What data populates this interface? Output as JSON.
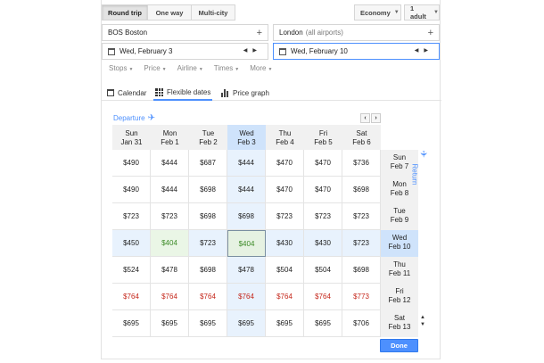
{
  "trip_types": [
    {
      "label": "Round trip",
      "active": true
    },
    {
      "label": "One way",
      "active": false
    },
    {
      "label": "Multi-city",
      "active": false
    }
  ],
  "cabin": {
    "label": "Economy"
  },
  "passengers": {
    "label": "1 adult"
  },
  "origin": {
    "code": "BOS",
    "city": "Boston"
  },
  "destination": {
    "city": "London",
    "note": "(all airports)"
  },
  "depart_date": "Wed, February 3",
  "return_date": "Wed, February 10",
  "filters": [
    "Stops",
    "Price",
    "Airline",
    "Times",
    "More"
  ],
  "views": [
    {
      "label": "Calendar",
      "icon": "calendar-icon"
    },
    {
      "label": "Flexible dates",
      "icon": "grid-icon",
      "active": true
    },
    {
      "label": "Price graph",
      "icon": "bar-chart-icon"
    }
  ],
  "departure_label": "Departure",
  "return_label": "Return",
  "departure_days": [
    {
      "dow": "Sun",
      "date": "Jan 31"
    },
    {
      "dow": "Mon",
      "date": "Feb 1"
    },
    {
      "dow": "Tue",
      "date": "Feb 2"
    },
    {
      "dow": "Wed",
      "date": "Feb 3"
    },
    {
      "dow": "Thu",
      "date": "Feb 4"
    },
    {
      "dow": "Fri",
      "date": "Feb 5"
    },
    {
      "dow": "Sat",
      "date": "Feb 6"
    }
  ],
  "return_days": [
    {
      "dow": "Sun",
      "date": "Feb 7"
    },
    {
      "dow": "Mon",
      "date": "Feb 8"
    },
    {
      "dow": "Tue",
      "date": "Feb 9"
    },
    {
      "dow": "Wed",
      "date": "Feb 10"
    },
    {
      "dow": "Thu",
      "date": "Feb 11"
    },
    {
      "dow": "Fri",
      "date": "Feb 12"
    },
    {
      "dow": "Sat",
      "date": "Feb 13"
    }
  ],
  "prices": [
    [
      "$490",
      "$444",
      "$687",
      "$444",
      "$470",
      "$470",
      "$736"
    ],
    [
      "$490",
      "$444",
      "$698",
      "$444",
      "$470",
      "$470",
      "$698"
    ],
    [
      "$723",
      "$723",
      "$698",
      "$698",
      "$723",
      "$723",
      "$723"
    ],
    [
      "$450",
      "$404",
      "$723",
      "$404",
      "$430",
      "$430",
      "$723"
    ],
    [
      "$524",
      "$478",
      "$698",
      "$478",
      "$504",
      "$504",
      "$698"
    ],
    [
      "$764",
      "$764",
      "$764",
      "$764",
      "$764",
      "$764",
      "$773"
    ],
    [
      "$695",
      "$695",
      "$695",
      "$695",
      "$695",
      "$695",
      "$706"
    ]
  ],
  "selected_departure_index": 3,
  "selected_return_index": 3,
  "colors": {
    "accent": "#4d90fe",
    "cheap": "#3b8a26",
    "expensive": "#c5271b",
    "selected_tint": "#e8f2fd"
  },
  "done_label": "Done"
}
